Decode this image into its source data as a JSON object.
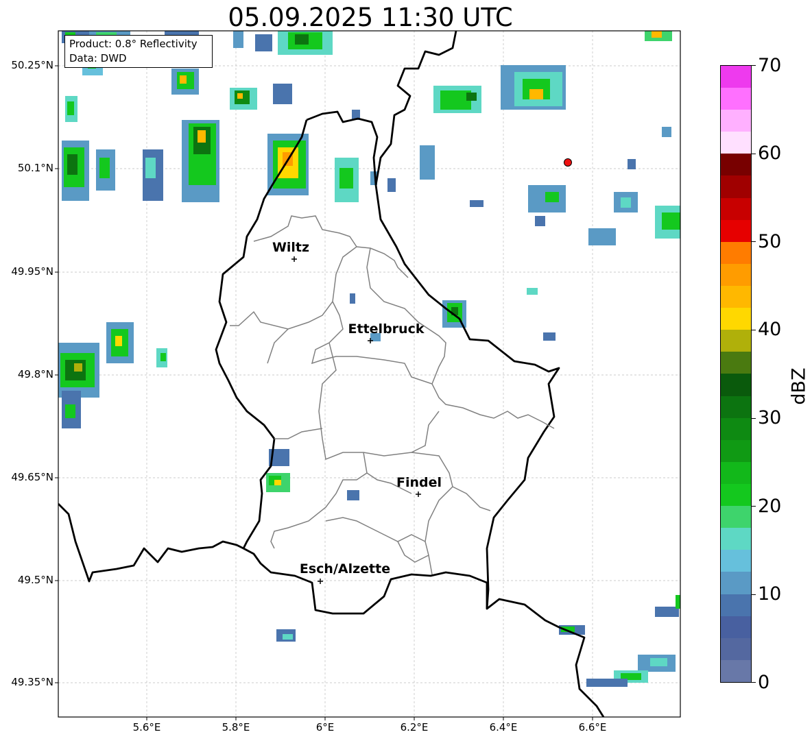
{
  "title": "05.09.2025 11:30 UTC",
  "info": {
    "product": "Product: 0.8° Reflectivity",
    "data": "Data: DWD"
  },
  "lat_labels": [
    "50.25°N",
    "50.1°N",
    "49.95°N",
    "49.8°N",
    "49.65°N",
    "49.5°N",
    "49.35°N"
  ],
  "lon_labels": [
    "5.6°E",
    "5.8°E",
    "6°E",
    "6.2°E",
    "6.4°E",
    "6.6°E"
  ],
  "cities": [
    {
      "name": "Wiltz"
    },
    {
      "name": "Ettelbruck"
    },
    {
      "name": "Findel"
    },
    {
      "name": "Esch/Alzette"
    }
  ],
  "colorbar": {
    "label": "dBZ",
    "ticks": [
      "0",
      "10",
      "20",
      "30",
      "40",
      "50",
      "60",
      "70"
    ],
    "colors": [
      "#6878a8",
      "#5468a0",
      "#4860a0",
      "#4a74ad",
      "#5a9ac5",
      "#66c0dc",
      "#5ed8c4",
      "#3ed46c",
      "#14c81e",
      "#12b81a",
      "#109a14",
      "#0e8a12",
      "#0c7410",
      "#0a5a0c",
      "#4a7a10",
      "#b0b00a",
      "#ffd800",
      "#ffb800",
      "#ff9c00",
      "#ff7c00",
      "#e60000",
      "#c80000",
      "#a00000",
      "#780000",
      "#ffe0ff",
      "#ffb0ff",
      "#ff70ff",
      "#ee3aee"
    ]
  },
  "marker_color": "#ee1111"
}
